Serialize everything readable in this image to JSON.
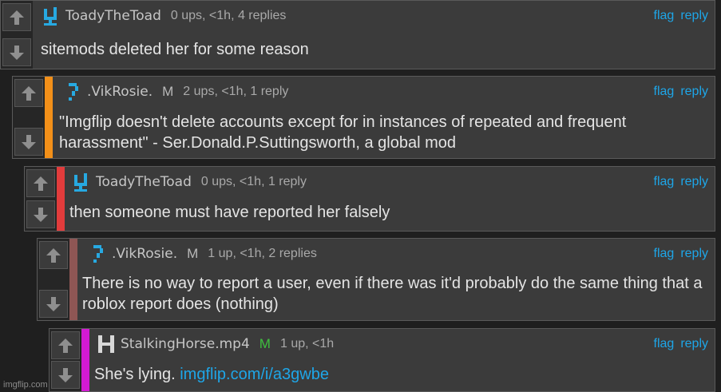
{
  "icons": {
    "upvote": "up-arrow-icon",
    "downvote": "down-arrow-icon"
  },
  "comments": [
    {
      "username": "ToadyTheToad",
      "mod_badge": "",
      "meta": "0 ups, <1h, 4 replies",
      "flag": "flag",
      "reply": "reply",
      "body": "sitemods deleted her for some reason",
      "bar_color": "",
      "avatar_color": "#27a9e1"
    },
    {
      "username": ".VikRosie.",
      "mod_badge": "M",
      "meta": "2 ups, <1h, 1 reply",
      "flag": "flag",
      "reply": "reply",
      "body": "\"Imgflip doesn't delete accounts except for in instances of repeated and frequent harassment\" - Ser.Donald.P.Suttingsworth, a global mod",
      "bar_color": "#f39019",
      "avatar_color": "#27a9e1"
    },
    {
      "username": "ToadyTheToad",
      "mod_badge": "",
      "meta": "0 ups, <1h, 1 reply",
      "flag": "flag",
      "reply": "reply",
      "body": "then someone must have reported her falsely",
      "bar_color": "#e23c3c",
      "avatar_color": "#27a9e1"
    },
    {
      "username": ".VikRosie.",
      "mod_badge": "M",
      "meta": "1 up, <1h, 2 replies",
      "flag": "flag",
      "reply": "reply",
      "body": "There is no way to report a user, even if there was it'd probably do the same thing that a roblox report does (nothing)",
      "bar_color": "#8e5654",
      "avatar_color": "#27a9e1"
    },
    {
      "username": "StalkingHorse.mp4",
      "mod_badge": "M",
      "meta": "1 up, <1h",
      "flag": "flag",
      "reply": "reply",
      "body": "She's lying.",
      "link": "imgflip.com/i/a3gwbe",
      "bar_color": "#d31ad3",
      "avatar_color": "#d8d8d8",
      "mod_color": "#3fbf3f"
    }
  ],
  "watermark": "imgflip.com"
}
